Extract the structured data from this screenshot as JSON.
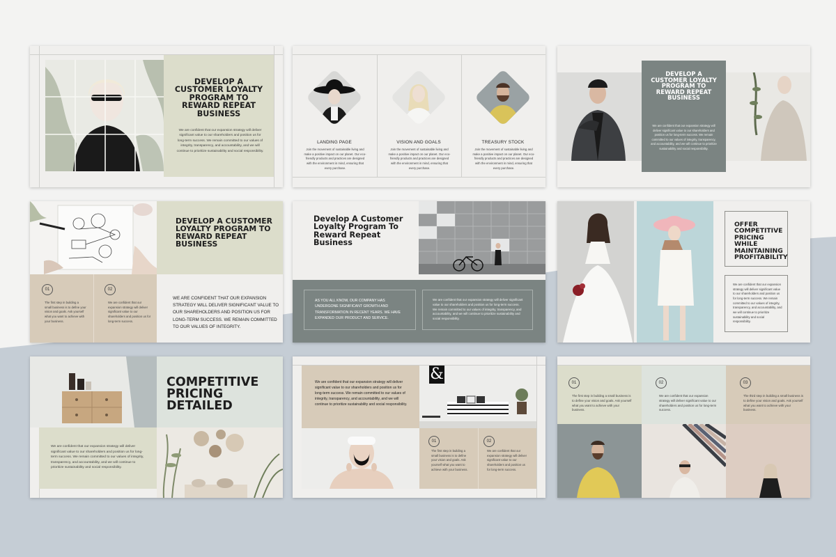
{
  "colors": {
    "page_bg": "#f3f3f2",
    "wave_blue": "#c5cdd5",
    "sage": "#dcddcb",
    "sage_grey": "#dde3dd",
    "tan": "#d7cbb9",
    "slate": "#7b8482",
    "panel_light": "#f0efed"
  },
  "slide1": {
    "title": "DEVELOP A CUSTOMER LOYALTY PROGRAM TO REWARD REPEAT BUSINESS",
    "body": "We are confident that our expansion strategy will deliver significant value to our shareholders and position us for long-term success. We remain committed to our values of integrity, transparency, and accountability, and we will continue to prioritize sustainability and social responsibility."
  },
  "slide2": {
    "columns": [
      {
        "caption": "LANDING PAGE",
        "body": "Join the movement of sustainable living and make a positive impact on our planet. Our eco-friendly products and practices are designed with the environment in mind, ensuring that every purchase."
      },
      {
        "caption": "VISION AND GOALS",
        "body": "Join the movement of sustainable living and make a positive impact on our planet. Our eco-friendly products and practices are designed with the environment in mind, ensuring that every purchase."
      },
      {
        "caption": "TREASURY STOCK",
        "body": "Join the movement of sustainable living and make a positive impact on our planet. Our eco-friendly products and practices are designed with the environment in mind, ensuring that every purchase."
      }
    ]
  },
  "slide3": {
    "title": "DEVELOP A CUSTOMER LOYALTY PROGRAM TO REWARD REPEAT BUSINESS",
    "body": "We are confident that our expansion strategy will deliver significant value to our shareholders and position us for long-term success. We remain committed to our values of integrity, transparency, and accountability, and we will continue to prioritize sustainability and social responsibility."
  },
  "slide4": {
    "title": "DEVELOP A CUSTOMER LOYALTY PROGRAM TO REWARD REPEAT BUSINESS",
    "steps": [
      {
        "num": "01",
        "body": "The first step in building a small business is to define your vision and goals. Ask yourself what you want to achieve with your business."
      },
      {
        "num": "02",
        "body": "We are confident that our expansion strategy will deliver significant value to our shareholders and position us for long-term success."
      }
    ],
    "statement": "WE ARE CONFIDENT THAT OUR EXPANSION STRATEGY WILL DELIVER SIGNIFICANT VALUE TO OUR SHAREHOLDERS AND POSITION US FOR LONG-TERM SUCCESS. WE REMAIN COMMITTED TO OUR VALUES OF INTEGRITY."
  },
  "slide5": {
    "title": "Develop A Customer Loyalty Program To Reward Repeat Business",
    "box1": "AS YOU ALL KNOW, OUR COMPANY HAS UNDERGONE SIGNIFICANT GROWTH AND TRANSFORMATION IN RECENT YEARS. WE HAVE EXPANDED OUR PRODUCT AND SERVICE.",
    "box2": "We are confident that our expansion strategy will deliver significant value to our shareholders and position us for long-term success. We remain committed to our values of integrity, transparency, and accountability, and we will continue to prioritize sustainability and social responsibility."
  },
  "slide6": {
    "title": "OFFER COMPETITIVE PRICING WHILE MAINTAINING PROFITABILITY",
    "body": "We are confident that our expansion strategy will deliver significant value to our shareholders and position us for long-term success. We remain committed to our values of integrity, transparency, and accountability, and we will continue to prioritize sustainability and social responsibility."
  },
  "slide7": {
    "title": "COMPETITIVE PRICING DETAILED",
    "body": "We are confident that our expansion strategy will deliver significant value to our shareholders and position us for long-term success. We remain committed to our values of integrity, transparency, and accountability, and we will continue to prioritize sustainability and social responsibility."
  },
  "slide8": {
    "body": "We are confident that our expansion strategy will deliver significant value to our shareholders and position us for long-term success. We remain committed to our values of integrity, transparency, and accountability, and we will continue to prioritize sustainability and social responsibility.",
    "poster_glyph": "&",
    "steps": [
      {
        "num": "01",
        "body": "The first step in building a small business is to define your vision and goals. Ask yourself what you want to achieve with your business."
      },
      {
        "num": "02",
        "body": "We are confident that our expansion strategy will deliver significant value to our shareholders and position us for long-term success."
      }
    ]
  },
  "slide9": {
    "steps": [
      {
        "num": "01",
        "body": "The first step in building a small business is to define your vision and goals. Ask yourself what you want to achieve with your business."
      },
      {
        "num": "02",
        "body": "We are confident that our expansion strategy will deliver significant value to our shareholders and position us for long-term success."
      },
      {
        "num": "03",
        "body": "The third step in building a small business is to define your vision and goals. Ask yourself what you want to achieve with your business."
      }
    ]
  }
}
